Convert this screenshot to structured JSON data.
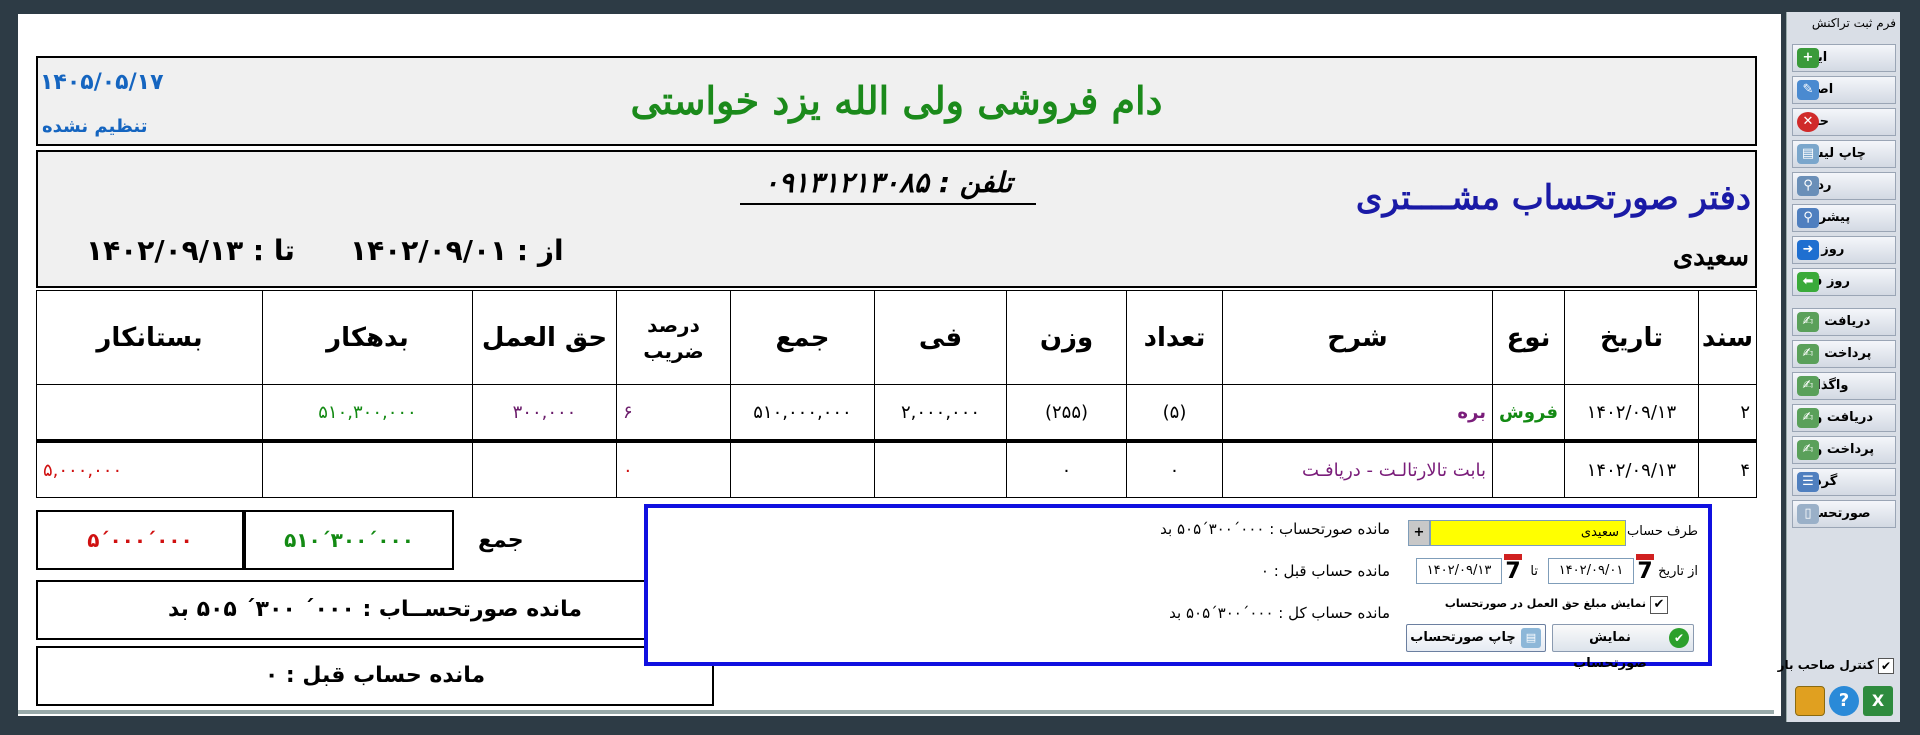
{
  "header": {
    "shop_name": "دام فروشی ولی الله یزد خواستی",
    "date": "۱۴۰۵/۰۵/۱۷",
    "status": "تنظیم نشده"
  },
  "info": {
    "title": "دفتر صورتحساب مشــــتری",
    "customer": "سعیدی",
    "phone": "تلفن : ۰۹۱۳۱۲۱۳۰۸۵",
    "from": "از : ۱۴۰۲/۰۹/۰۱",
    "to": "تا : ۱۴۰۲/۰۹/۱۳"
  },
  "table": {
    "headers": {
      "doc": "سند",
      "date": "تاریخ",
      "type": "نوع",
      "desc": "شرح",
      "count": "تعداد",
      "weight": "وزن",
      "price": "فی",
      "total": "جمع",
      "rate": "درصد ضریب",
      "commission": "حق العمل",
      "debtor": "بدهکار",
      "creditor": "بستانکار"
    },
    "rows": [
      {
        "doc": "۲",
        "date": "۱۴۰۲/۰۹/۱۳",
        "type": "فروش",
        "desc": "بره",
        "count": "(۵)",
        "weight": "(۲۵۵)",
        "price": "۲,۰۰۰,۰۰۰",
        "total": "۵۱۰,۰۰۰,۰۰۰",
        "rate": "۶",
        "commission": "۳۰۰,۰۰۰",
        "debtor": "۵۱۰,۳۰۰,۰۰۰",
        "creditor": ""
      },
      {
        "doc": "۴",
        "date": "۱۴۰۲/۰۹/۱۳",
        "type": "",
        "desc": "بابت تالارتالـت - دریافـت",
        "count": "۰",
        "weight": "۰",
        "price": "",
        "total": "",
        "rate": "۰",
        "commission": "",
        "debtor": "",
        "creditor": "۵,۰۰۰,۰۰۰"
      }
    ]
  },
  "summary": {
    "label": "جمع",
    "debtor": "۵۱۰´۳۰۰´۰۰۰",
    "creditor": "۵´۰۰۰´۰۰۰",
    "balance": "مانده صورتحســاب : ۰۰۰´ ۳۰۰´ ۵۰۵  بد",
    "previous": "مانده حساب قبل : ۰"
  },
  "popup": {
    "party_label": "طرف حساب",
    "party_value": "سعیدی",
    "from_label": "از تاریخ",
    "from_value": "۱۴۰۲/۰۹/۰۱",
    "to_label": "تا",
    "to_value": "۱۴۰۲/۰۹/۱۳",
    "stmt_balance": "مانده صورتحساب : ۰۰۰´۳۰۰´۵۰۵   بد",
    "prev_balance": "مانده حساب قبل : ۰",
    "total_balance": "مانده حساب کل : ۰۰۰´۳۰۰´۵۰۵   بد",
    "checkbox_label": "نمایش مبلغ حق العمل در صورتحساب",
    "show_button": "نمایش صورتحساب",
    "print_button": "چاپ صورتحساب",
    "cal_day": "7"
  },
  "sidebar": {
    "title": "فرم ثبت تراکنش",
    "items": [
      "ایجاد",
      "اصلاح",
      "حذف",
      "چاپ لیست",
      "ردیف",
      "پیشرفته",
      "روز بعد",
      "روز قبل",
      "دریافت چک",
      "پرداخت چک",
      "واگذاری",
      "دریافت وجه",
      "پرداخت وجه",
      "گردش",
      "صورتحساب"
    ],
    "owner_label": "کنترل صاحب بار"
  }
}
